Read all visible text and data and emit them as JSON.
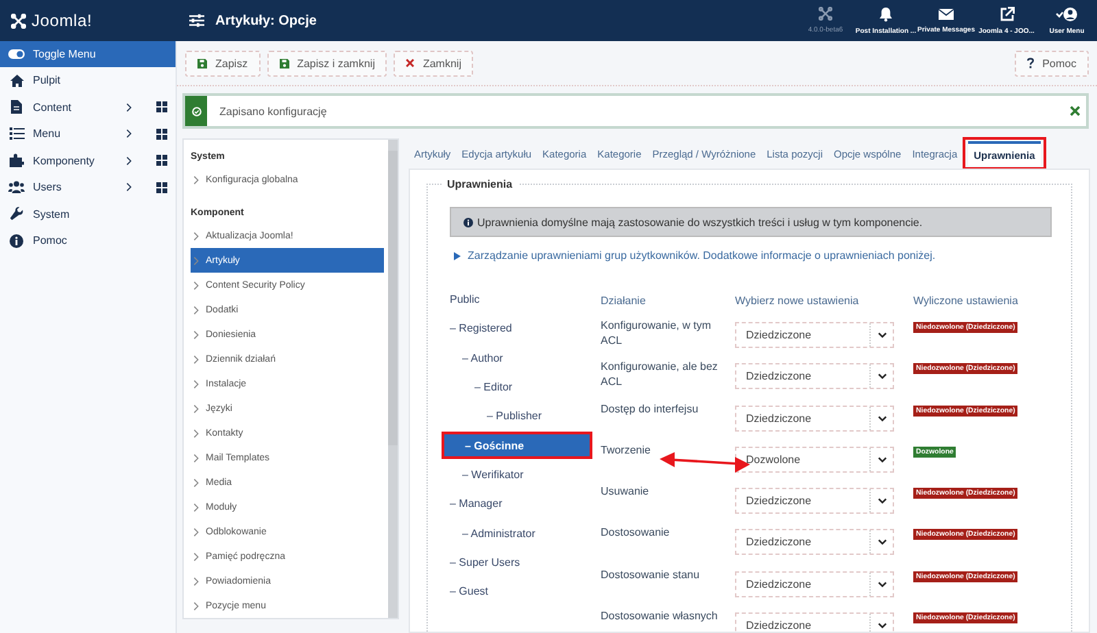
{
  "header": {
    "logo": "Joomla!",
    "title": "Artykuły: Opcje",
    "items": [
      {
        "kind": "joomla",
        "label": "4.0.0-beta6"
      },
      {
        "kind": "bell",
        "label": "Post Installation ..."
      },
      {
        "kind": "envelope",
        "label": "Private Messages"
      },
      {
        "kind": "external",
        "label": "Joomla 4 - JOO..."
      },
      {
        "kind": "user",
        "label": "User Menu"
      }
    ]
  },
  "sidebar": {
    "items": [
      {
        "kind": "toggle",
        "label": "Toggle Menu",
        "expandable": false
      },
      {
        "kind": "home",
        "label": "Pulpit",
        "expandable": false
      },
      {
        "kind": "file",
        "label": "Content",
        "expandable": true
      },
      {
        "kind": "list",
        "label": "Menu",
        "expandable": true
      },
      {
        "kind": "puzzle",
        "label": "Komponenty",
        "expandable": true
      },
      {
        "kind": "users",
        "label": "Users",
        "expandable": true
      },
      {
        "kind": "wrench",
        "label": "System",
        "expandable": false
      },
      {
        "kind": "info",
        "label": "Pomoc",
        "expandable": false
      }
    ]
  },
  "toolbar": {
    "buttons": [
      {
        "kind": "save",
        "label": "Zapisz"
      },
      {
        "kind": "save",
        "label": "Zapisz i zamknij"
      },
      {
        "kind": "close",
        "label": "Zamknij"
      }
    ],
    "help": {
      "label": "Pomoc"
    }
  },
  "alert": {
    "message": "Zapisano konfigurację"
  },
  "components": {
    "sections": [
      {
        "title": "System",
        "items": [
          {
            "label": "Konfiguracja globalna",
            "selected": false
          }
        ]
      },
      {
        "title": "Komponent",
        "items": [
          {
            "label": "Aktualizacja Joomla!",
            "selected": false
          },
          {
            "label": "Artykuły",
            "selected": true
          },
          {
            "label": "Content Security Policy",
            "selected": false
          },
          {
            "label": "Dodatki",
            "selected": false
          },
          {
            "label": "Doniesienia",
            "selected": false
          },
          {
            "label": "Dziennik działań",
            "selected": false
          },
          {
            "label": "Instalacje",
            "selected": false
          },
          {
            "label": "Języki",
            "selected": false
          },
          {
            "label": "Kontakty",
            "selected": false
          },
          {
            "label": "Mail Templates",
            "selected": false
          },
          {
            "label": "Media",
            "selected": false
          },
          {
            "label": "Moduły",
            "selected": false
          },
          {
            "label": "Odblokowanie",
            "selected": false
          },
          {
            "label": "Pamięć podręczna",
            "selected": false
          },
          {
            "label": "Powiadomienia",
            "selected": false
          },
          {
            "label": "Pozycje menu",
            "selected": false
          }
        ]
      }
    ]
  },
  "tabs": [
    {
      "label": "Artykuły",
      "selected": false,
      "highlighted": false
    },
    {
      "label": "Edycja artykułu",
      "selected": false,
      "highlighted": false
    },
    {
      "label": "Kategoria",
      "selected": false,
      "highlighted": false
    },
    {
      "label": "Kategorie",
      "selected": false,
      "highlighted": false
    },
    {
      "label": "Przegląd / Wyróżnione",
      "selected": false,
      "highlighted": false
    },
    {
      "label": "Lista pozycji",
      "selected": false,
      "highlighted": false
    },
    {
      "label": "Opcje wspólne",
      "selected": false,
      "highlighted": false
    },
    {
      "label": "Integracja",
      "selected": false,
      "highlighted": false
    },
    {
      "label": "Uprawnienia",
      "selected": true,
      "highlighted": true
    }
  ],
  "permissions": {
    "legend": "Uprawnienia",
    "info": "Uprawnienia domyślne mają zastosowanie do wszystkich treści i usług w tym komponencie.",
    "link": "Zarządzanie uprawnieniami grup użytkowników. Dodatkowe informacje o uprawnieniach poniżej.",
    "groups": [
      {
        "label": "Public",
        "selected": false,
        "highlighted": false,
        "children": [
          {
            "label": "– Registered",
            "selected": false,
            "highlighted": false,
            "children": [
              {
                "label": "– Author",
                "selected": false,
                "highlighted": false,
                "children": [
                  {
                    "label": "– Editor",
                    "selected": false,
                    "highlighted": false,
                    "children": [
                      {
                        "label": "– Publisher",
                        "selected": false,
                        "highlighted": false
                      }
                    ]
                  }
                ]
              },
              {
                "label": "– Gościnne",
                "selected": true,
                "highlighted": true
              },
              {
                "label": "– Werifikator",
                "selected": false,
                "highlighted": false
              }
            ]
          },
          {
            "label": "– Manager",
            "selected": false,
            "highlighted": false,
            "children": [
              {
                "label": "– Administrator",
                "selected": false,
                "highlighted": false
              }
            ]
          },
          {
            "label": "– Super Users",
            "selected": false,
            "highlighted": false
          },
          {
            "label": "– Guest",
            "selected": false,
            "highlighted": false
          }
        ]
      }
    ],
    "columns": [
      "Działanie",
      "Wybierz nowe ustawienia",
      "Wyliczone ustawienia"
    ],
    "rows": [
      {
        "action": "Konfigurowanie, w tym ACL",
        "setting": "Dziedziczone",
        "result": "Niedozwolone (Dziedziczone)",
        "allowed": false
      },
      {
        "action": "Konfigurowanie, ale bez ACL",
        "setting": "Dziedziczone",
        "result": "Niedozwolone (Dziedziczone)",
        "allowed": false
      },
      {
        "action": "Dostęp do interfejsu",
        "setting": "Dziedziczone",
        "result": "Niedozwolone (Dziedziczone)",
        "allowed": false
      },
      {
        "action": "Tworzenie",
        "setting": "Dozwolone",
        "result": "Dozwolone",
        "allowed": true
      },
      {
        "action": "Usuwanie",
        "setting": "Dziedziczone",
        "result": "Niedozwolone (Dziedziczone)",
        "allowed": false
      },
      {
        "action": "Dostosowanie",
        "setting": "Dziedziczone",
        "result": "Niedozwolone (Dziedziczone)",
        "allowed": false
      },
      {
        "action": "Dostosowanie stanu",
        "setting": "Dziedziczone",
        "result": "Niedozwolone (Dziedziczone)",
        "allowed": false
      },
      {
        "action": "Dostosowanie własnych",
        "setting": "Dziedziczone",
        "result": "Niedozwolone (Dziedziczone)",
        "allowed": false
      }
    ]
  }
}
